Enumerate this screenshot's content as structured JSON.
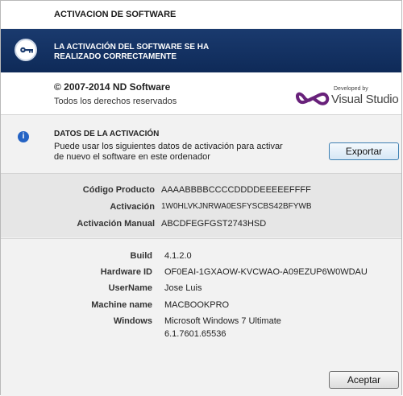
{
  "title": "ACTIVACION DE SOFTWARE",
  "banner": {
    "icon": "key-icon",
    "line1": "LA ACTIVACIÓN DEL SOFTWARE SE HA",
    "line2": "REALIZADO CORRECTAMENTE"
  },
  "about": {
    "copyright": "© 2007-2014 ND Software",
    "rights": "Todos los derechos reservados",
    "logo": {
      "developed_by": "Developed by",
      "name": "Visual Studio"
    }
  },
  "activation": {
    "heading": "DATOS DE LA ACTIVACIÓN",
    "line1": "Puede usar los siguientes datos de activación para activar",
    "line2": "de nuevo el software en este ordenador",
    "export_label": "Exportar"
  },
  "codes": [
    {
      "label": "Código Producto",
      "value": "AAAABBBBCCCCDDDDEEEEEFFFF"
    },
    {
      "label": "Activación",
      "value": "1W0HLVKJNRWA0ESFYSCBS42BFYWB"
    },
    {
      "label": "Activación Manual",
      "value": "ABCDFEGFGST2743HSD"
    }
  ],
  "system": [
    {
      "label": "Build",
      "value": "4.1.2.0"
    },
    {
      "label": "Hardware ID",
      "value": "OF0EAI-1GXAOW-KVCWAO-A09EZUP6W0WDAU"
    },
    {
      "label": "UserName",
      "value": "Jose Luis"
    },
    {
      "label": "Machine name",
      "value": "MACBOOKPRO"
    },
    {
      "label": "Windows",
      "value": "Microsoft Windows 7 Ultimate",
      "value2": "6.1.7601.65536"
    }
  ],
  "ok_label": "Aceptar",
  "colors": {
    "banner": "#0e2a58",
    "info_icon": "#2463c4",
    "vs_logo": "#68217a"
  }
}
